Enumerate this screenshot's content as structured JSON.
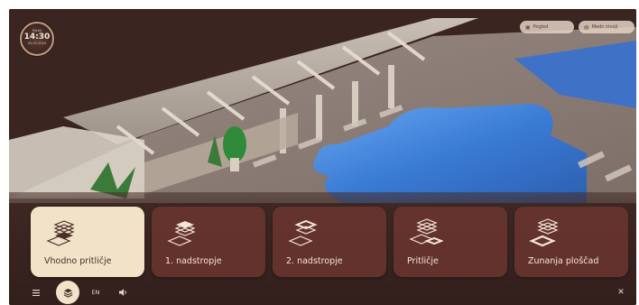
{
  "clock": {
    "top_label": "Petek",
    "time": "14:30",
    "date": "02.02.2024"
  },
  "top_buttons": [
    {
      "label": "Pogled",
      "icon": "view-icon"
    },
    {
      "label": "Medn nivoji",
      "icon": "layers-small-icon"
    }
  ],
  "floors": [
    {
      "label": "Vhodno pritličje",
      "active": true
    },
    {
      "label": "1. nadstropje",
      "active": false
    },
    {
      "label": "2. nadstropje",
      "active": false
    },
    {
      "label": "Pritličje",
      "active": false
    },
    {
      "label": "Zunanja ploščad",
      "active": false
    }
  ],
  "toolbar": {
    "menu_icon": "menu-icon",
    "layers_icon": "layers-icon",
    "language": "EN",
    "sound_icon": "sound-icon",
    "close_icon": "close-icon"
  },
  "colors": {
    "background": "#3a2521",
    "card": "#68342f",
    "card_active": "#f2e2c8",
    "pool": "#3a7bd5",
    "deck": "#8a7b73"
  }
}
